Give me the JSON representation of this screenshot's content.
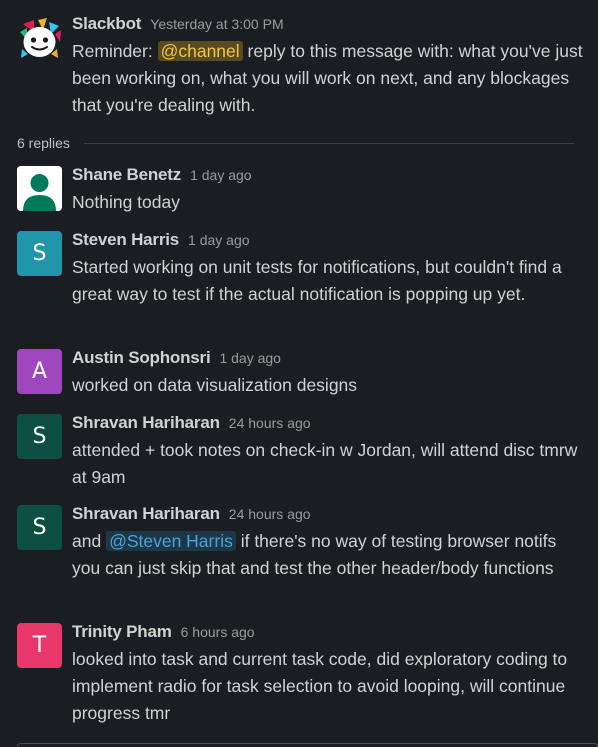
{
  "parent": {
    "author": "Slackbot",
    "time": "Yesterday at 3:00 PM",
    "text_before": "Reminder: ",
    "mention": "@channel",
    "text_after": " reply to this message with: what you've just been working on, what you will work on next, and any blockages that you're dealing with."
  },
  "replies_label": "6 replies",
  "replies": [
    {
      "author": "Shane Benetz",
      "time": "1 day ago",
      "initial": "",
      "avatar_color": "#ffffff",
      "text": "Nothing today"
    },
    {
      "author": "Steven Harris",
      "time": "1 day ago",
      "initial": "S",
      "avatar_color": "#1f96a9",
      "text": "Started working on unit tests for notifications, but couldn't find a great way to test if the actual notification is popping up yet."
    },
    {
      "author": "Austin Sophonsri",
      "time": "1 day ago",
      "initial": "A",
      "avatar_color": "#9f48bd",
      "text": "worked on data visualization designs"
    },
    {
      "author": "Shravan Hariharan",
      "time": "24 hours ago",
      "initial": "S",
      "avatar_color": "#0e4f43",
      "text": "attended + took notes on check-in w Jordan, will attend disc tmrw at 9am"
    },
    {
      "author": "Shravan Hariharan",
      "time": "24 hours ago",
      "initial": "S",
      "avatar_color": "#0e4f43",
      "text_before": "and ",
      "mention": "@Steven Harris",
      "text_after": " if there's no way of testing browser notifs you can just skip that and test the other header/body functions"
    },
    {
      "author": "Trinity Pham",
      "time": "6 hours ago",
      "initial": "T",
      "avatar_color": "#e8376b",
      "text": "looked into task and current task code, did exploratory coding to implement radio for task selection to avoid looping, will continue progress tmr"
    }
  ],
  "colors": {
    "background": "#1a1d21",
    "channel_mention_bg": "#594a1f",
    "channel_mention_fg": "#f2c744",
    "user_mention_bg": "#1d3746",
    "user_mention_fg": "#4aa3df"
  }
}
